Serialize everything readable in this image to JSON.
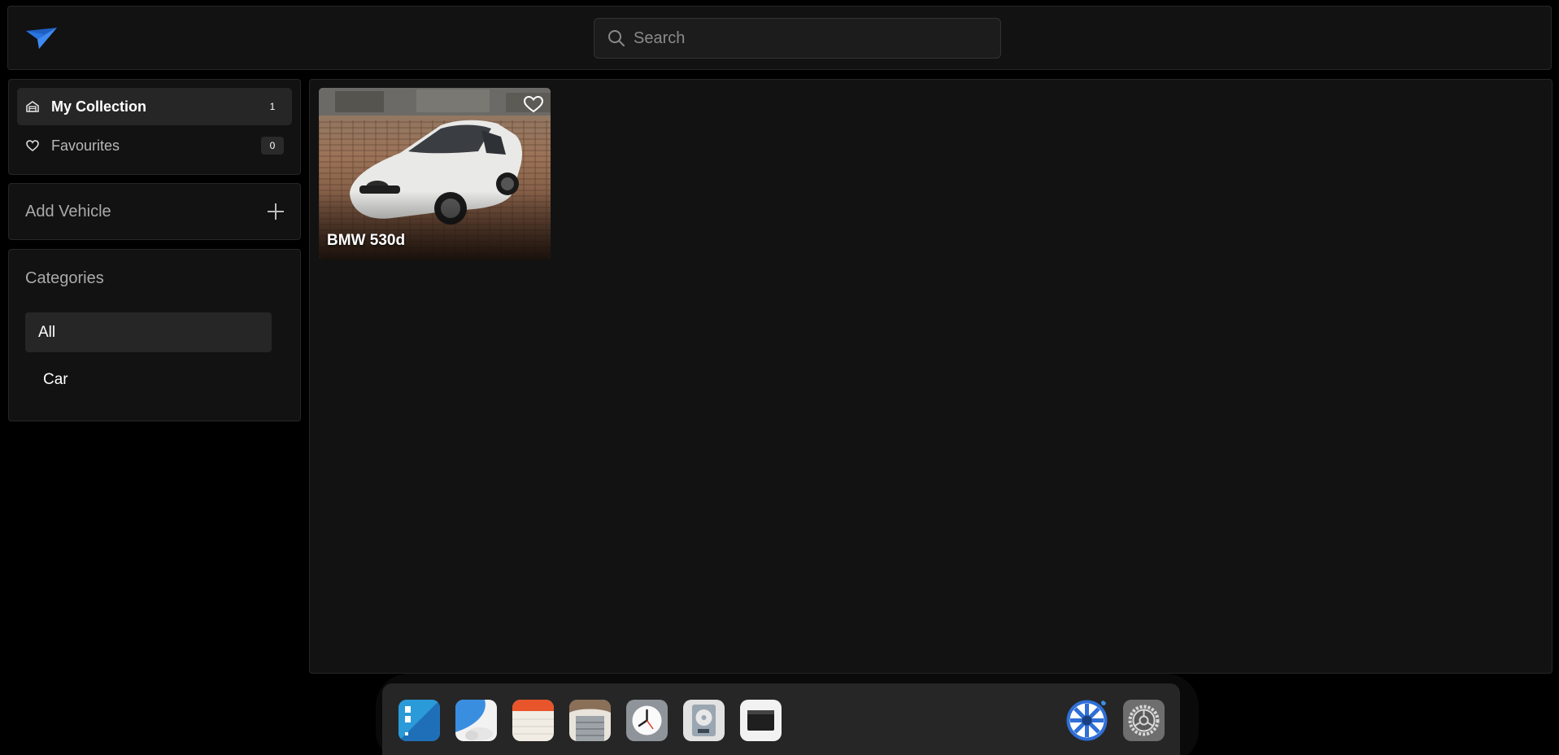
{
  "header": {
    "search_placeholder": "Search"
  },
  "collections": {
    "items": [
      {
        "label": "My Collection",
        "count": "1",
        "icon": "garage-icon",
        "active": true
      },
      {
        "label": "Favourites",
        "count": "0",
        "icon": "heart-icon",
        "active": false
      }
    ]
  },
  "add_vehicle": {
    "label": "Add Vehicle"
  },
  "categories": {
    "title": "Categories",
    "items": [
      {
        "label": "All",
        "active": true
      },
      {
        "label": "Car",
        "active": false
      }
    ]
  },
  "vehicles": [
    {
      "name": "BMW 530d",
      "favourite": false
    }
  ],
  "dock": {
    "apps": [
      "dashboard-app-icon",
      "weather-app-icon",
      "notes-app-icon",
      "garage-app-icon",
      "clock-app-icon",
      "disk-app-icon",
      "window-app-icon",
      "wheel-app-icon",
      "settings-app-icon"
    ]
  },
  "colors": {
    "background": "#000000",
    "panel": "#121212",
    "active_item": "#262626",
    "accent_blue": "#2f6fd6"
  }
}
